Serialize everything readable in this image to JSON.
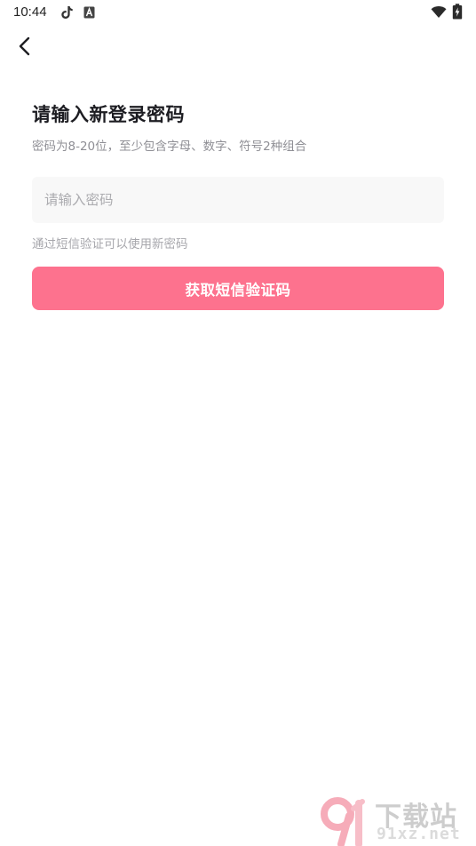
{
  "status_bar": {
    "time": "10:44",
    "left_icons": [
      "tiktok-icon",
      "font-app-icon"
    ],
    "right_icons": [
      "wifi-icon",
      "battery-charging-icon"
    ]
  },
  "nav": {
    "back_icon": "chevron-left-icon"
  },
  "form": {
    "title": "请输入新登录密码",
    "subtitle": "密码为8-20位，至少包含字母、数字、符号2种组合",
    "password_placeholder": "请输入密码",
    "password_value": "",
    "hint": "通过短信验证可以使用新密码",
    "submit_label": "获取短信验证码"
  },
  "colors": {
    "accent": "#fd728e",
    "input_background": "#f8f8f8",
    "subtitle_text": "#8f8f95",
    "hint_text": "#a7a7ac"
  },
  "watermark": {
    "brand": "下载站",
    "domain": "91xz.net"
  }
}
